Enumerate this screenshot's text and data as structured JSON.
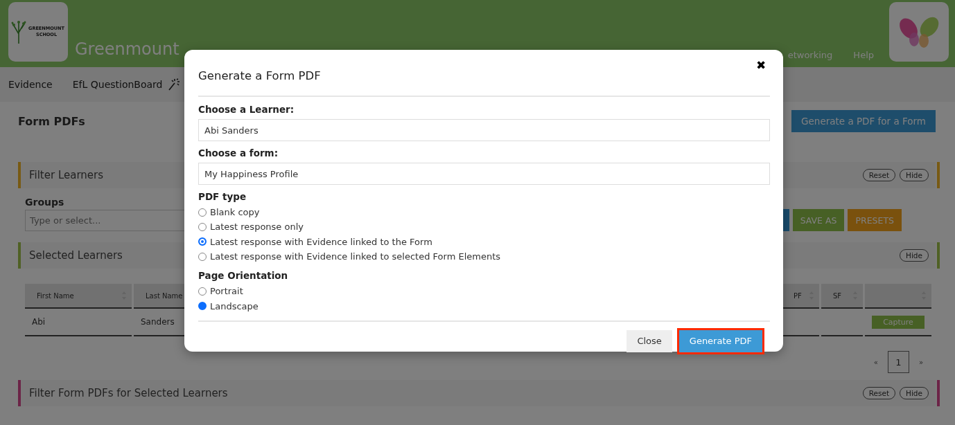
{
  "header": {
    "logo_caption": "GREENMOUNT SCHOOL",
    "school_name": "Greenmount",
    "nav": [
      "etworking",
      "Help"
    ]
  },
  "nav_bar": [
    {
      "label": "Evidence",
      "icon": false
    },
    {
      "label": "EfL QuestionBoard",
      "icon": true
    }
  ],
  "page": {
    "title": "Form PDFs",
    "action": "Generate a PDF for a Form",
    "filter_learners": {
      "title": "Filter Learners",
      "buttons": [
        "Reset",
        "Hide"
      ],
      "groups_label": "Groups",
      "groups_placeholder": "Type or select...",
      "actions": [
        {
          "kind": "search"
        },
        {
          "kind": "save",
          "label": "SAVE AS"
        },
        {
          "kind": "presets",
          "label": "PRESETS"
        }
      ]
    },
    "selected_learners": {
      "title": "Selected Learners",
      "buttons": [
        "Hide"
      ],
      "table": {
        "columns": [
          "First Name",
          "Last Name",
          "",
          "PF",
          "SF",
          ""
        ],
        "rows": [
          {
            "cells": [
              "Abi",
              "Sanders",
              "",
              "",
              "",
              ""
            ],
            "action": "Capture"
          }
        ]
      },
      "pagination": {
        "prev": "«",
        "pages": [
          {
            "label": "1",
            "selected": true
          }
        ],
        "next": "»"
      }
    },
    "filter_pdfs": {
      "title": "Filter Form PDFs for Selected Learners",
      "buttons": [
        "Reset",
        "Hide"
      ]
    }
  },
  "modal": {
    "title": "Generate a Form PDF",
    "close_icon": "✖",
    "learner_label": "Choose a Learner:",
    "learner_value": "Abi Sanders",
    "form_label": "Choose a form:",
    "form_value": "My Happiness Profile",
    "pdf_type_label": "PDF type",
    "pdf_types": [
      {
        "label": "Blank copy",
        "selected": false
      },
      {
        "label": "Latest response only",
        "selected": false
      },
      {
        "label": "Latest response with Evidence linked to the Form",
        "selected": true
      },
      {
        "label": "Latest response with Evidence linked to selected Form Elements",
        "selected": false
      }
    ],
    "orientation_label": "Page Orientation",
    "orientations": [
      {
        "label": "Portrait",
        "selected": false
      },
      {
        "label": "Landscape",
        "selected": true
      }
    ],
    "buttons": [
      {
        "label": "Close",
        "kind": "secondary",
        "highlighted": false
      },
      {
        "label": "Generate PDF",
        "kind": "primary",
        "highlighted": true
      }
    ]
  }
}
